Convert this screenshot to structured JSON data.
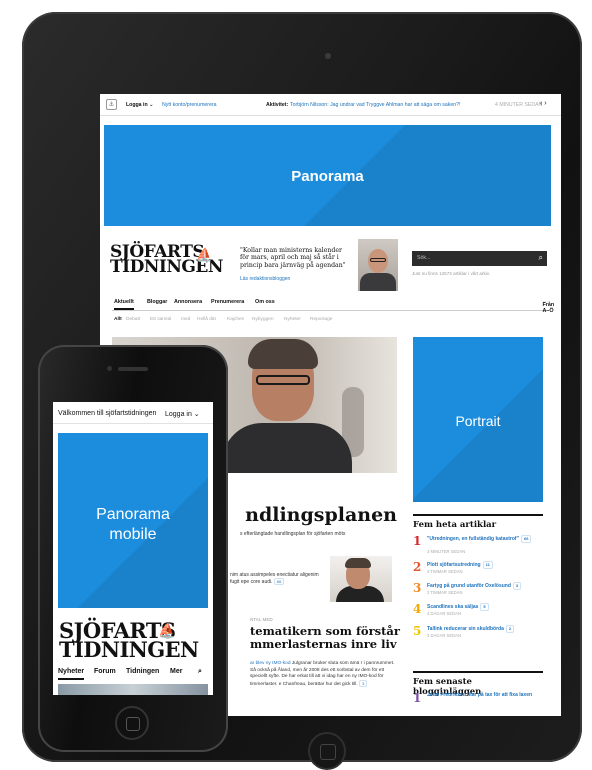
{
  "ipad": {
    "topbar": {
      "login": "Logga in",
      "new_account": "Nytt konto/prenumerera",
      "activity_label": "Aktivitet:",
      "activity_text": "Torbjörn Nilsson: Jag undrar vad Tryggve Ahlman har att säga om saken?!",
      "activity_time": "4 MINUTER SEDAN",
      "arrows": "‹ ›"
    },
    "panorama_label": "Panorama",
    "masthead": {
      "brand_line1": "SJÖFARTS",
      "brand_line2": "TIDNINGEN",
      "quote": "\"Kollar man ministerns kalender för mars, april och maj så står i princip bara järnväg på agendan\"",
      "quote_link": "Läs redaktionsbloggen",
      "search_placeholder": "Sök...",
      "search_hint": "Just nu finns 12573 artiklar i vårt arkiv."
    },
    "main_nav": [
      "Aktuellt",
      "Bloggar",
      "Annonsera",
      "Prenumerera",
      "Om oss"
    ],
    "main_nav_right": "Från A–Ö",
    "sub_nav": [
      "Allt",
      "Debatt",
      "Ett samtal",
      "med",
      "Hellå där",
      "Kajchen",
      "Nybyggen",
      "Nyheter",
      "Reportage"
    ],
    "article": {
      "headline": "ndlingsplanen",
      "lead": "s efterlängtade handlingsplan för sjöfarten möts",
      "teaser_text": "nim atus assimpeles enectiatur aligenim fugit epe core audi.",
      "teaser_count": "66",
      "section_label": "NTAL MED",
      "headline2": "tematikern som förstår mmerlasternas inre liv",
      "lead2_link": "ar blev ny IMO-kod",
      "lead2": "Julgranar bruker sluta som ämä r i pannrummet. Så också på Åland, men år 2008 des ett sorbstal av dem för ett speciellt syfte. De har erkat till att vi idag har en ny IMO-kod för timmerlaster. e Chanfreau, berättar hur det gick till.",
      "lead2_count": "3"
    },
    "portrait_label": "Portrait",
    "hot_title": "Fem heta artiklar",
    "hot_items": [
      {
        "num": "1",
        "title": "\"Utredningen, en fullständig katastrof\"",
        "count": "66",
        "time": "3 MINUTER SEDAN",
        "color": "#d62828"
      },
      {
        "num": "2",
        "title": "Plott sjöfartsutredning",
        "count": "11",
        "time": "4 TIMMAR SEDAN",
        "color": "#e4572e"
      },
      {
        "num": "3",
        "title": "Fartyg på grund utanför Oxelösund",
        "count": "3",
        "time": "2 TIMMAR SEDAN",
        "color": "#f08a24"
      },
      {
        "num": "4",
        "title": "Scandlines ska säljas",
        "count": "5",
        "time": "4 DAGAR SEDAN",
        "color": "#f2a900"
      },
      {
        "num": "5",
        "title": "Tallink reducerar sin skuldbörda",
        "count": "2",
        "time": "3 DAGAR SEDAN",
        "color": "#f5c400"
      }
    ],
    "blog_title": "Fem senaste blogginläggen",
    "blog_item": "John Fredriksen litar på tax för att fixa laxen"
  },
  "iphone": {
    "welcome": "Välkommen till sjöfartstidningen",
    "login": "Logga in",
    "panorama_label": "Panorama mobile",
    "brand_line1": "SJÖFARTS",
    "brand_line2": "TIDNINGEN",
    "nav": [
      "Nyheter",
      "Forum",
      "Tidningen",
      "Mer"
    ]
  },
  "colors": {
    "accent_blue": "#1c8cdc",
    "link_blue": "#1e73be",
    "device_black": "#1b1b1b"
  }
}
